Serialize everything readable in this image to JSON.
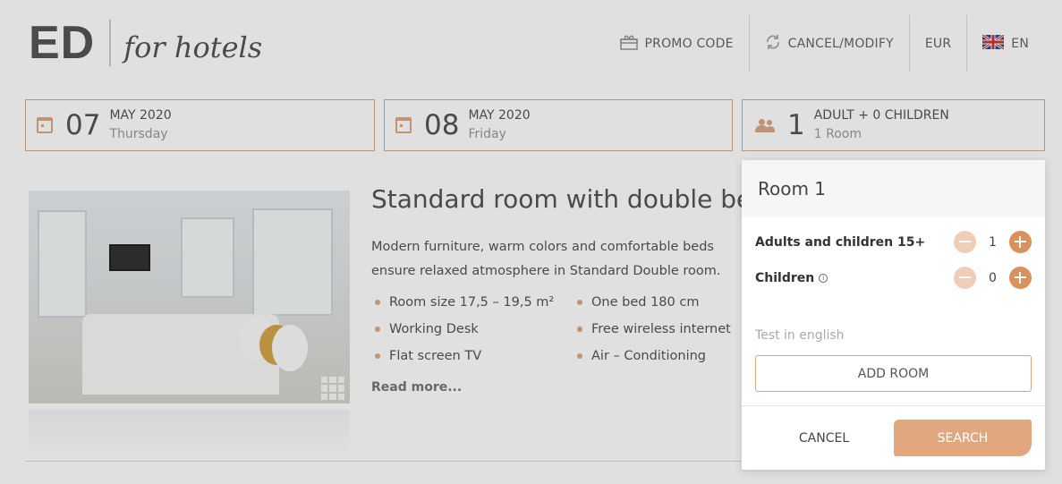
{
  "header": {
    "logo_main": "ED",
    "logo_tagline": "for hotels",
    "nav": {
      "promo_code": "PROMO CODE",
      "cancel_modify": "CANCEL/MODIFY",
      "currency": "EUR",
      "language": "EN"
    }
  },
  "search": {
    "checkin": {
      "day": "07",
      "month_year": "MAY 2020",
      "weekday": "Thursday"
    },
    "checkout": {
      "day": "08",
      "month_year": "MAY 2020",
      "weekday": "Friday"
    },
    "guests": {
      "count": "1",
      "summary": "ADULT + 0 CHILDREN",
      "rooms": "1 Room"
    }
  },
  "room": {
    "title": "Standard room with double bed",
    "description": "Modern furniture, warm colors and comfortable beds ensure relaxed atmosphere in Standard Double room.",
    "features_left": [
      "Room size 17,5 – 19,5 m²",
      "Working Desk",
      "Flat screen TV"
    ],
    "features_right": [
      "One bed 180 cm",
      "Free wireless internet",
      "Air – Conditioning"
    ],
    "read_more": "Read more..."
  },
  "popup": {
    "title": "Room 1",
    "adults_label": "Adults and children 15+",
    "adults_value": "1",
    "children_label": "Children",
    "children_value": "0",
    "note": "Test in english",
    "add_room": "ADD ROOM",
    "cancel": "CANCEL",
    "search": "SEARCH"
  },
  "colors": {
    "accent": "#d9a985",
    "accent_button": "#e1a77e",
    "plus_button": "#d9915d"
  },
  "icons": [
    "gift-icon",
    "refresh-icon",
    "uk-flag-icon",
    "calendar-icon",
    "people-icon",
    "gallery-icon",
    "info-icon",
    "minus-icon",
    "plus-icon"
  ]
}
